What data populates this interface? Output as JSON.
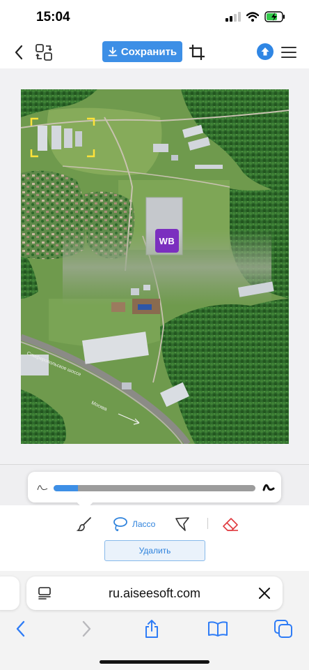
{
  "status_bar": {
    "time": "15:04",
    "icons": [
      "signal-icon",
      "wifi-icon",
      "battery-charging-icon"
    ]
  },
  "toolbar": {
    "save_label": "Сохранить",
    "icons": [
      "back-icon",
      "swap-images-icon",
      "download-icon",
      "crop-icon",
      "upload-icon",
      "menu-icon"
    ]
  },
  "photo": {
    "logo_text": "WB",
    "road_labels": [
      "Симферопольское шоссе",
      "Москва"
    ]
  },
  "brush_size": {
    "fraction": 0.12,
    "icons": [
      "thin-stroke-icon",
      "thick-stroke-icon"
    ]
  },
  "tools": {
    "lasso_label": "Лассо",
    "delete_label": "Удалить",
    "icons": [
      "brush-icon",
      "lasso-icon",
      "polygon-lasso-icon",
      "eraser-icon"
    ]
  },
  "browser": {
    "url": "ru.aiseesoft.com",
    "icons": [
      "reader-icon",
      "close-icon",
      "back-icon",
      "forward-icon",
      "share-icon",
      "bookmarks-icon",
      "tabs-icon"
    ]
  },
  "colors": {
    "accent": "#3d8fe6",
    "wb_purple": "#7b2fbf",
    "eraser_red": "#e0393e"
  }
}
